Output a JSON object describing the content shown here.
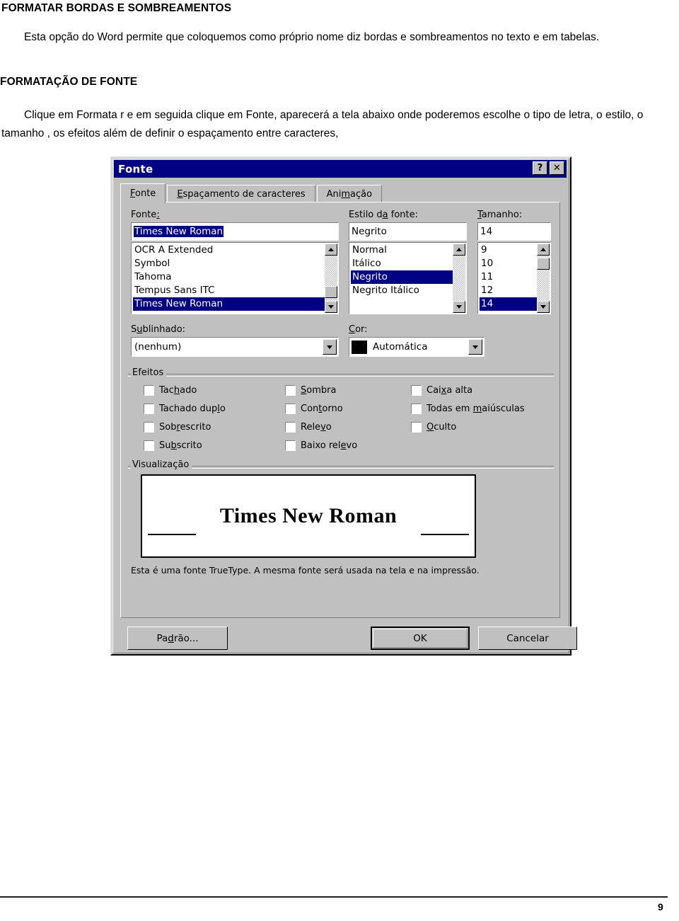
{
  "document": {
    "heading1": "FORMATAR BORDAS E SOMBREAMENTOS",
    "paragraph1": "Esta opção do Word permite que coloquemos como próprio nome diz bordas e sombreamentos no texto e em tabelas.",
    "heading2": "FORMATAÇÃO DE FONTE",
    "paragraph2": "Clique em Formata r e em seguida clique em Fonte, aparecerá a tela abaixo onde poderemos escolhe o tipo de letra, o estilo, o tamanho , os efeitos além de definir o espaçamento entre caracteres,",
    "page_number": "9"
  },
  "dialog": {
    "title": "Fonte",
    "titlebar": {
      "help_button": "?",
      "close_button": "✕"
    },
    "tabs": [
      {
        "label": "Fonte",
        "active": true
      },
      {
        "label": "Espaçamento de caracteres",
        "active": false
      },
      {
        "label": "Animação",
        "active": false
      }
    ],
    "font": {
      "label": "Fonte:",
      "value": "Times New Roman",
      "options": [
        "OCR A Extended",
        "Symbol",
        "Tahoma",
        "Tempus Sans ITC",
        "Times New Roman"
      ],
      "selected": "Times New Roman"
    },
    "font_style": {
      "label": "Estilo da fonte:",
      "value": "Negrito",
      "options": [
        "Normal",
        "Itálico",
        "Negrito",
        "Negrito Itálico"
      ],
      "selected": "Negrito"
    },
    "size": {
      "label": "Tamanho:",
      "value": "14",
      "options": [
        "9",
        "10",
        "11",
        "12",
        "14"
      ],
      "selected": "14"
    },
    "underline": {
      "label": "Sublinhado:",
      "value": "(nenhum)"
    },
    "color": {
      "label": "Cor:",
      "value": "Automática",
      "swatch": "#000000"
    },
    "effects": {
      "label": "Efeitos",
      "column1": [
        {
          "label": "Tachado",
          "checked": false
        },
        {
          "label": "Tachado duplo",
          "checked": false
        },
        {
          "label": "Sobrescrito",
          "checked": false
        },
        {
          "label": "Subscrito",
          "checked": false
        }
      ],
      "column2": [
        {
          "label": "Sombra",
          "checked": false
        },
        {
          "label": "Contorno",
          "checked": false
        },
        {
          "label": "Relevo",
          "checked": false
        },
        {
          "label": "Baixo relevo",
          "checked": false
        }
      ],
      "column3": [
        {
          "label": "Caixa alta",
          "checked": false
        },
        {
          "label": "Todas em maiúsculas",
          "checked": false
        },
        {
          "label": "Oculto",
          "checked": false
        }
      ]
    },
    "preview": {
      "label": "Visualização",
      "sample_text": "Times New Roman",
      "note": "Esta é uma fonte TrueType. A mesma fonte será usada na tela e na impressão."
    },
    "buttons": {
      "default": "Padrão...",
      "ok": "OK",
      "cancel": "Cancelar"
    },
    "colors": {
      "face": "#c0c0c0",
      "titlebar": "#000082",
      "selection": "#000082",
      "selection_text": "#ffffff"
    }
  }
}
